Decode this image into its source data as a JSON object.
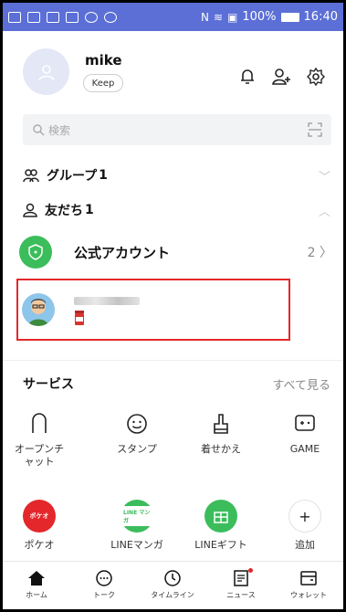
{
  "status_bar": {
    "battery": "100%",
    "time": "16:40"
  },
  "profile": {
    "name": "mike",
    "keep_label": "Keep"
  },
  "search": {
    "placeholder": "検索"
  },
  "groups": {
    "label": "グループ",
    "count": "1"
  },
  "friends": {
    "label": "友だち",
    "count": "1"
  },
  "official_accounts": {
    "label": "公式アカウント",
    "count": "2"
  },
  "services": {
    "title": "サービス",
    "see_all": "すべて見る",
    "row1": [
      {
        "label": "オープンチ",
        "label2": "ャット",
        "icon": "openchat-icon"
      },
      {
        "label": "スタンプ",
        "label2": "",
        "icon": "smiley-icon"
      },
      {
        "label": "着せかえ",
        "label2": "",
        "icon": "brush-icon"
      },
      {
        "label": "GAME",
        "label2": "",
        "icon": "game-icon"
      }
    ],
    "row2": [
      {
        "label": "ポケオ",
        "badge": "ポケオ",
        "color": "#e4272b"
      },
      {
        "label": "LINEマンガ",
        "badge": "LINE マンガ",
        "color": "#3bbd5b"
      },
      {
        "label": "LINEギフト",
        "badge": "",
        "color": "#3bbd5b"
      },
      {
        "label": "追加",
        "badge": "+",
        "color": "#ffffff"
      }
    ]
  },
  "bottom_nav": [
    {
      "label": "ホーム",
      "icon": "home-icon"
    },
    {
      "label": "トーク",
      "icon": "talk-icon"
    },
    {
      "label": "タイムライン",
      "icon": "timeline-icon"
    },
    {
      "label": "ニュース",
      "icon": "news-icon"
    },
    {
      "label": "ウォレット",
      "icon": "wallet-icon"
    }
  ],
  "colors": {
    "status_bar": "#5b6fd6",
    "line_green": "#3bbd5b",
    "highlight": "#e4272b"
  }
}
